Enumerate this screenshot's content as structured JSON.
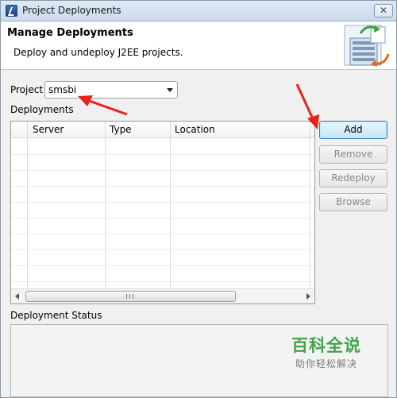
{
  "window": {
    "title": "Project Deployments",
    "close_glyph": "✕"
  },
  "header": {
    "title": "Manage Deployments",
    "subtitle": "Deploy and undeploy J2EE projects."
  },
  "project": {
    "label": "Project",
    "selected": "smsbi"
  },
  "deployments": {
    "label": "Deployments",
    "columns": [
      "Server",
      "Type",
      "Location"
    ],
    "rows": []
  },
  "buttons": {
    "add": "Add",
    "remove": "Remove",
    "redeploy": "Redeploy",
    "browse": "Browse"
  },
  "status": {
    "label": "Deployment Status"
  },
  "watermark": {
    "main": "百科全说",
    "sub": "助你轻松解决"
  },
  "colors": {
    "annotation_arrow": "#e8231b",
    "watermark_green": "#41a44a"
  },
  "icons": {
    "app": "eclipse-myeclipse-icon",
    "header": "deploy-server-icon",
    "dropdown": "chevron-down-icon"
  }
}
